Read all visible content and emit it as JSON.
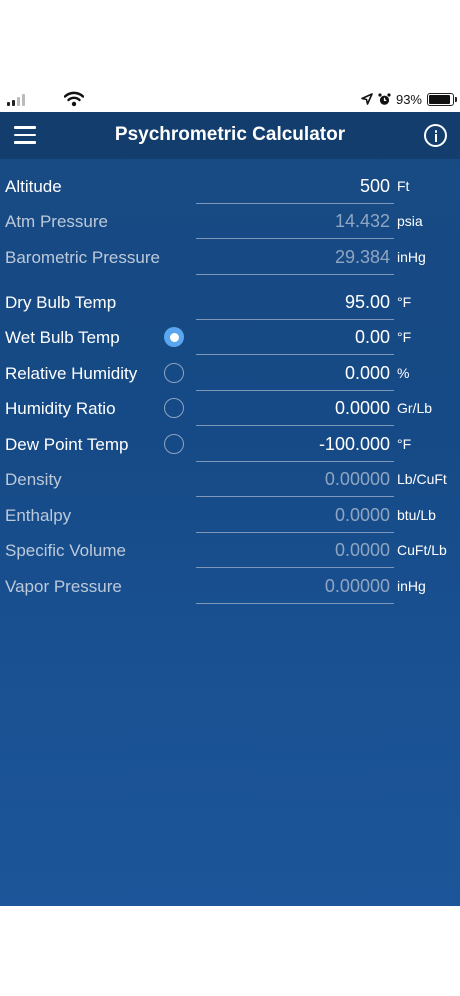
{
  "status_bar": {
    "signal_icon": "cellular-signal-icon",
    "wifi_icon": "wifi-icon",
    "location_icon": "location-arrow-icon",
    "alarm_icon": "alarm-clock-icon",
    "battery_percent": "93%",
    "battery_level": 0.93
  },
  "navbar": {
    "menu_icon": "hamburger-menu-icon",
    "title": "Psychrometric Calculator",
    "info_icon": "info-icon"
  },
  "fields": [
    {
      "label": "Altitude",
      "value": "500",
      "unit": "Ft",
      "editable": true,
      "radio": null
    },
    {
      "label": "Atm Pressure",
      "value": "14.432",
      "unit": "psia",
      "editable": false,
      "radio": null
    },
    {
      "label": "Barometric Pressure",
      "value": "29.384",
      "unit": "inHg",
      "editable": false,
      "radio": null
    },
    {
      "label": "Dry Bulb Temp",
      "value": "95.00",
      "unit": "°F",
      "editable": true,
      "radio": null
    },
    {
      "label": "Wet Bulb Temp",
      "value": "0.00",
      "unit": "°F",
      "editable": true,
      "radio": "selected"
    },
    {
      "label": "Relative Humidity",
      "value": "0.000",
      "unit": "%",
      "editable": true,
      "radio": "unselected"
    },
    {
      "label": "Humidity Ratio",
      "value": "0.0000",
      "unit": "Gr/Lb",
      "editable": true,
      "radio": "unselected"
    },
    {
      "label": "Dew Point Temp",
      "value": "-100.000",
      "unit": "°F",
      "editable": true,
      "radio": "unselected"
    },
    {
      "label": "Density",
      "value": "0.00000",
      "unit": "Lb/CuFt",
      "editable": false,
      "radio": null
    },
    {
      "label": "Enthalpy",
      "value": "0.0000",
      "unit": "btu/Lb",
      "editable": false,
      "radio": null
    },
    {
      "label": "Specific Volume",
      "value": "0.0000",
      "unit": "CuFt/Lb",
      "editable": false,
      "radio": null
    },
    {
      "label": "Vapor Pressure",
      "value": "0.00000",
      "unit": "inHg",
      "editable": false,
      "radio": null
    }
  ],
  "colors": {
    "navbar": "#133d6c",
    "background": "#184a82",
    "radio_selected": "#5aa7ef"
  }
}
